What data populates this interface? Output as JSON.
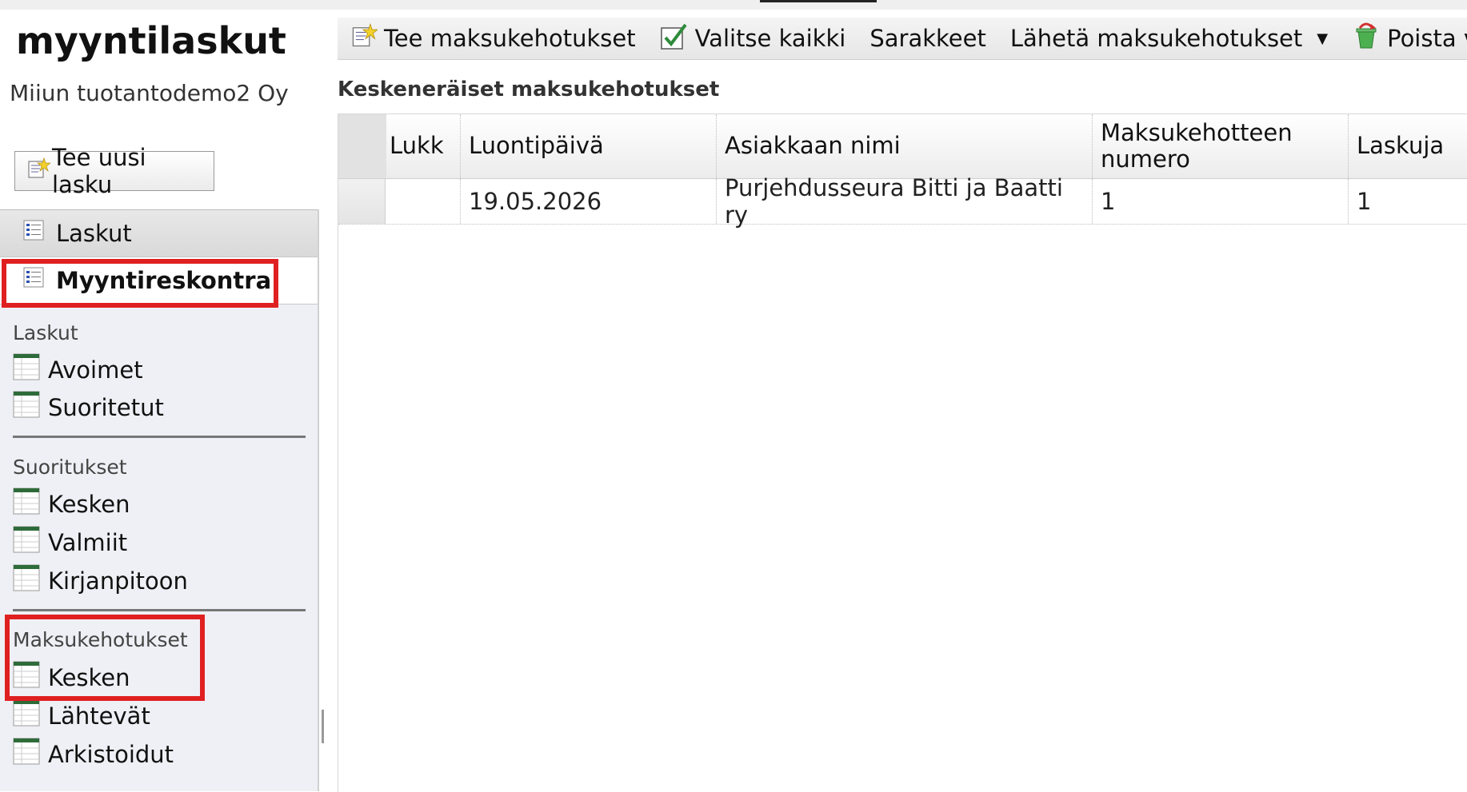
{
  "app": {
    "title": "myyntilaskut",
    "company": "Miiun tuotantodemo2 Oy",
    "new_invoice_label": "Tee uusi lasku"
  },
  "nav": {
    "header_invoices": "Laskut",
    "header_ledger": "Myyntireskontra",
    "sections": [
      {
        "label": "Laskut",
        "items": [
          "Avoimet",
          "Suoritetut"
        ]
      },
      {
        "label": "Suoritukset",
        "items": [
          "Kesken",
          "Valmiit",
          "Kirjanpitoon"
        ]
      },
      {
        "label": "Maksukehotukset",
        "items": [
          "Kesken",
          "Lähtevät",
          "Arkistoidut"
        ]
      }
    ]
  },
  "toolbar": {
    "create_label": "Tee maksukehotukset",
    "select_all_label": "Valitse kaikki",
    "columns_label": "Sarakkeet",
    "send_label": "Lähetä maksukehotukset",
    "delete_label": "Poista valitut"
  },
  "grid": {
    "title": "Keskeneräiset maksukehotukset",
    "columns": [
      "Lukk",
      "Luontipäivä",
      "Asiakkaan nimi",
      "Maksukehotteen numero",
      "Laskuja"
    ],
    "rows": [
      {
        "lukk": "",
        "created": "19.05.2026",
        "customer": "Purjehdusseura Bitti ja Baatti ry",
        "number": "1",
        "invoices": "1"
      }
    ]
  },
  "colors": {
    "highlight": "#e02020",
    "sidebar_bg": "#eff0f5",
    "icon_green": "#2e6b3a"
  }
}
